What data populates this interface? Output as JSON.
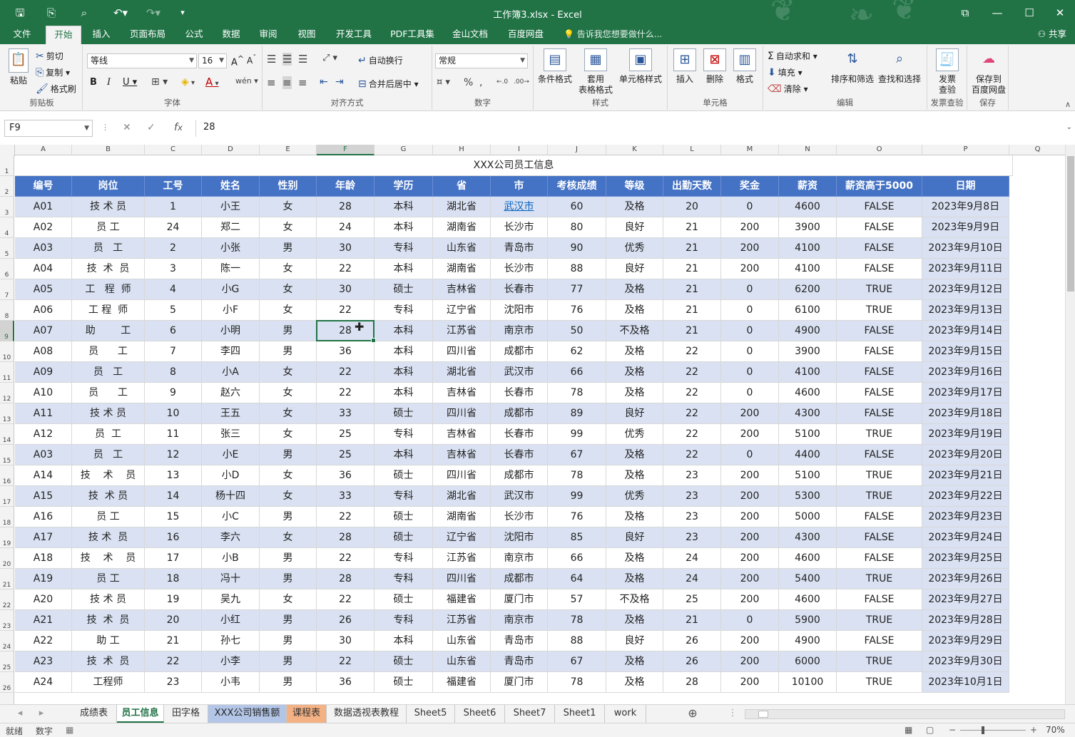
{
  "window": {
    "title": "工作簿3.xlsx - Excel"
  },
  "menu_tabs": [
    "文件",
    "开始",
    "插入",
    "页面布局",
    "公式",
    "数据",
    "审阅",
    "视图",
    "开发工具",
    "PDF工具集",
    "金山文档",
    "百度网盘"
  ],
  "tellme": "告诉我您想要做什么...",
  "share": "共享",
  "ribbon": {
    "clipboard": {
      "paste": "粘贴",
      "cut": "剪切",
      "copy": "复制",
      "format_painter": "格式刷",
      "label": "剪贴板"
    },
    "font": {
      "name": "等线",
      "size": "16",
      "bold": "B",
      "italic": "I",
      "underline": "U",
      "label": "字体"
    },
    "alignment": {
      "wrap": "自动换行",
      "merge": "合并后居中",
      "label": "对齐方式"
    },
    "number": {
      "format": "常规",
      "label": "数字"
    },
    "styles": {
      "cond": "条件格式",
      "table_l1": "套用",
      "table_l2": "表格格式",
      "cell": "单元格样式",
      "label": "样式"
    },
    "cells": {
      "insert": "插入",
      "delete": "删除",
      "format": "格式",
      "label": "单元格"
    },
    "editing": {
      "autosum": "自动求和",
      "fill": "填充",
      "clear": "清除",
      "sort": "排序和筛选",
      "find": "查找和选择",
      "label": "编辑"
    },
    "invoice": {
      "l1": "发票",
      "l2": "查验",
      "label": "发票查验"
    },
    "save": {
      "l1": "保存到",
      "l2": "百度网盘",
      "label": "保存"
    }
  },
  "formula_bar": {
    "name_box": "F9",
    "value": "28"
  },
  "columns": [
    "A",
    "B",
    "C",
    "D",
    "E",
    "F",
    "G",
    "H",
    "I",
    "J",
    "K",
    "L",
    "M",
    "N",
    "O",
    "P",
    "Q"
  ],
  "sheet_title": "XXX公司员工信息",
  "headers": [
    "编号",
    "岗位",
    "工号",
    "姓名",
    "性别",
    "年龄",
    "学历",
    "省",
    "市",
    "考核成绩",
    "等级",
    "出勤天数",
    "奖金",
    "薪资",
    "薪资高于5000",
    "日期"
  ],
  "rows": [
    [
      "A01",
      "技 术 员",
      "1",
      "小王",
      "女",
      "28",
      "本科",
      "湖北省",
      "武汉市",
      "60",
      "及格",
      "20",
      "0",
      "4600",
      "FALSE",
      "2023年9月8日"
    ],
    [
      "A02",
      "员 工",
      "24",
      "郑二",
      "女",
      "24",
      "本科",
      "湖南省",
      "长沙市",
      "80",
      "良好",
      "21",
      "200",
      "3900",
      "FALSE",
      "2023年9月9日"
    ],
    [
      "A03",
      "员   工",
      "2",
      "小张",
      "男",
      "30",
      "专科",
      "山东省",
      "青岛市",
      "90",
      "优秀",
      "21",
      "200",
      "4100",
      "FALSE",
      "2023年9月10日"
    ],
    [
      "A04",
      "技  术  员",
      "3",
      "陈一",
      "女",
      "22",
      "本科",
      "湖南省",
      "长沙市",
      "88",
      "良好",
      "21",
      "200",
      "4100",
      "FALSE",
      "2023年9月11日"
    ],
    [
      "A05",
      "工   程  师",
      "4",
      "小G",
      "女",
      "30",
      "硕士",
      "吉林省",
      "长春市",
      "77",
      "及格",
      "21",
      "0",
      "6200",
      "TRUE",
      "2023年9月12日"
    ],
    [
      "A06",
      "工 程  师",
      "5",
      "小F",
      "女",
      "22",
      "专科",
      "辽宁省",
      "沈阳市",
      "76",
      "及格",
      "21",
      "0",
      "6100",
      "TRUE",
      "2023年9月13日"
    ],
    [
      "A07",
      "助        工",
      "6",
      "小明",
      "男",
      "28",
      "本科",
      "江苏省",
      "南京市",
      "50",
      "不及格",
      "21",
      "0",
      "4900",
      "FALSE",
      "2023年9月14日"
    ],
    [
      "A08",
      "员      工",
      "7",
      "李四",
      "男",
      "36",
      "本科",
      "四川省",
      "成都市",
      "62",
      "及格",
      "22",
      "0",
      "3900",
      "FALSE",
      "2023年9月15日"
    ],
    [
      "A09",
      "员   工",
      "8",
      "小A",
      "女",
      "22",
      "本科",
      "湖北省",
      "武汉市",
      "66",
      "及格",
      "22",
      "0",
      "4100",
      "FALSE",
      "2023年9月16日"
    ],
    [
      "A10",
      "员      工",
      "9",
      "赵六",
      "女",
      "22",
      "本科",
      "吉林省",
      "长春市",
      "78",
      "及格",
      "22",
      "0",
      "4600",
      "FALSE",
      "2023年9月17日"
    ],
    [
      "A11",
      "技 术 员",
      "10",
      "王五",
      "女",
      "33",
      "硕士",
      "四川省",
      "成都市",
      "89",
      "良好",
      "22",
      "200",
      "4300",
      "FALSE",
      "2023年9月18日"
    ],
    [
      "A12",
      "员  工",
      "11",
      "张三",
      "女",
      "25",
      "专科",
      "吉林省",
      "长春市",
      "99",
      "优秀",
      "22",
      "200",
      "5100",
      "TRUE",
      "2023年9月19日"
    ],
    [
      "A03",
      "员   工",
      "12",
      "小E",
      "男",
      "25",
      "本科",
      "吉林省",
      "长春市",
      "67",
      "及格",
      "22",
      "0",
      "4400",
      "FALSE",
      "2023年9月20日"
    ],
    [
      "A14",
      "技    术    员",
      "13",
      "小D",
      "女",
      "36",
      "硕士",
      "四川省",
      "成都市",
      "78",
      "及格",
      "23",
      "200",
      "5100",
      "TRUE",
      "2023年9月21日"
    ],
    [
      "A15",
      "技  术 员",
      "14",
      "杨十四",
      "女",
      "33",
      "专科",
      "湖北省",
      "武汉市",
      "99",
      "优秀",
      "23",
      "200",
      "5300",
      "TRUE",
      "2023年9月22日"
    ],
    [
      "A16",
      "员 工",
      "15",
      "小C",
      "男",
      "22",
      "硕士",
      "湖南省",
      "长沙市",
      "76",
      "及格",
      "23",
      "200",
      "5000",
      "FALSE",
      "2023年9月23日"
    ],
    [
      "A17",
      "技 术  员",
      "16",
      "李六",
      "女",
      "28",
      "硕士",
      "辽宁省",
      "沈阳市",
      "85",
      "良好",
      "23",
      "200",
      "4300",
      "FALSE",
      "2023年9月24日"
    ],
    [
      "A18",
      "技    术    员",
      "17",
      "小B",
      "男",
      "22",
      "专科",
      "江苏省",
      "南京市",
      "66",
      "及格",
      "24",
      "200",
      "4600",
      "FALSE",
      "2023年9月25日"
    ],
    [
      "A19",
      "员 工",
      "18",
      "冯十",
      "男",
      "28",
      "专科",
      "四川省",
      "成都市",
      "64",
      "及格",
      "24",
      "200",
      "5400",
      "TRUE",
      "2023年9月26日"
    ],
    [
      "A20",
      "技 术 员",
      "19",
      "吴九",
      "女",
      "22",
      "硕士",
      "福建省",
      "厦门市",
      "57",
      "不及格",
      "25",
      "200",
      "4600",
      "FALSE",
      "2023年9月27日"
    ],
    [
      "A21",
      "技  术  员",
      "20",
      "小红",
      "男",
      "26",
      "专科",
      "江苏省",
      "南京市",
      "78",
      "及格",
      "21",
      "0",
      "5900",
      "TRUE",
      "2023年9月28日"
    ],
    [
      "A22",
      "助 工",
      "21",
      "孙七",
      "男",
      "30",
      "本科",
      "山东省",
      "青岛市",
      "88",
      "良好",
      "26",
      "200",
      "4900",
      "FALSE",
      "2023年9月29日"
    ],
    [
      "A23",
      "技  术  员",
      "22",
      "小李",
      "男",
      "22",
      "硕士",
      "山东省",
      "青岛市",
      "67",
      "及格",
      "26",
      "200",
      "6000",
      "TRUE",
      "2023年9月30日"
    ],
    [
      "A24",
      "工程师",
      "23",
      "小韦",
      "男",
      "36",
      "硕士",
      "福建省",
      "厦门市",
      "78",
      "及格",
      "28",
      "200",
      "10100",
      "TRUE",
      "2023年10月1日"
    ]
  ],
  "sheet_tabs": [
    "成绩表",
    "员工信息",
    "田字格",
    "XXX公司销售额",
    "课程表",
    "数据透视表教程",
    "Sheet5",
    "Sheet6",
    "Sheet7",
    "Sheet1",
    "work"
  ],
  "active_sheet": "员工信息",
  "status": {
    "ready": "就绪",
    "mode": "数字",
    "zoom": "70%"
  },
  "colors": {
    "excel_green": "#217346",
    "header_blue": "#4472c4",
    "band": "#d9e1f2",
    "link": "#0563c1"
  }
}
